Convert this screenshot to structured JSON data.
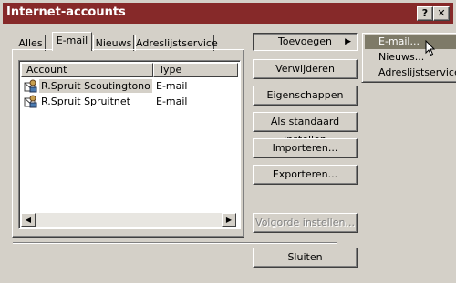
{
  "window": {
    "title": "Internet-accounts"
  },
  "titlebar_buttons": {
    "help": "?",
    "close": "✕"
  },
  "tabs": [
    {
      "label": "Alles",
      "active": false
    },
    {
      "label": "E-mail",
      "active": true
    },
    {
      "label": "Nieuws",
      "active": false
    },
    {
      "label": "Adreslijstservice",
      "active": false
    }
  ],
  "list": {
    "columns": [
      "Account",
      "Type"
    ],
    "rows": [
      {
        "account": "R.Spruit Scoutingtono",
        "type": "E-mail",
        "selected": true,
        "icon": "mail-account-icon"
      },
      {
        "account": "R.Spruit Spruitnet",
        "type": "E-mail",
        "selected": false,
        "icon": "mail-account-icon"
      }
    ]
  },
  "buttons": {
    "add": "Toevoegen",
    "remove": "Verwijderen",
    "properties": "Eigenschappen",
    "set_default": "Als standaard instellen",
    "import": "Importeren...",
    "export": "Exporteren...",
    "order": "Volgorde instellen...",
    "close": "Sluiten"
  },
  "add_menu": {
    "items": [
      {
        "label": "E-mail...",
        "highlighted": true
      },
      {
        "label": "Nieuws...",
        "highlighted": false
      },
      {
        "label": "Adreslijstservice...",
        "highlighted": false
      }
    ]
  },
  "colors": {
    "titlebar": "#862929",
    "face": "#d4d0c8",
    "menu_highlight": "#7e7a68"
  }
}
